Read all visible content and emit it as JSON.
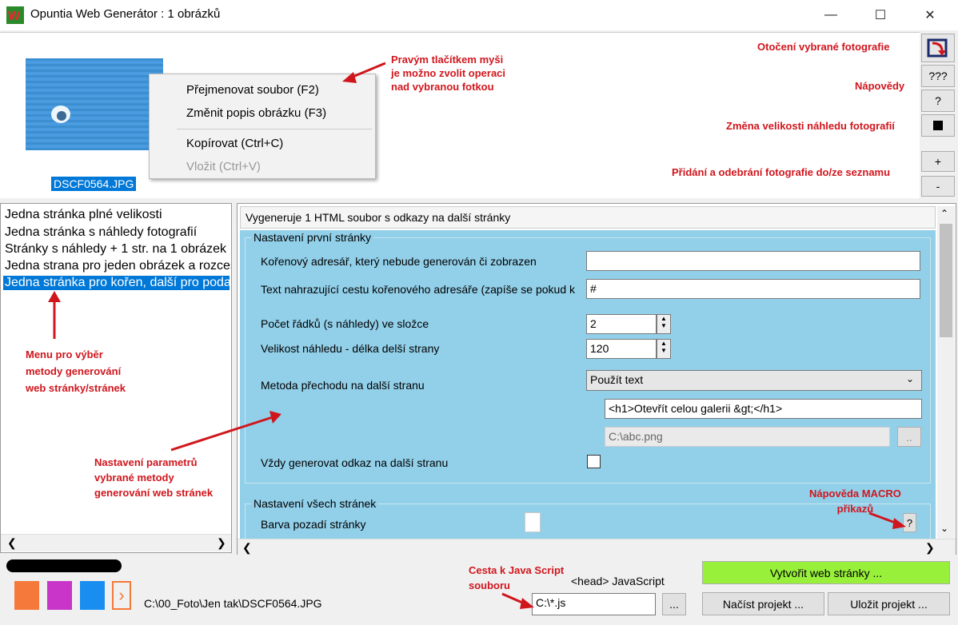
{
  "window": {
    "title": "Opuntia Web Generátor : 1 obrázků"
  },
  "thumbnail": {
    "filename": "DSCF0564.JPG"
  },
  "context_menu": {
    "items": [
      "Přejmenovat soubor (F2)",
      "Změnit popis obrázku (F3)",
      "Kopírovat (Ctrl+C)"
    ],
    "disabled_item": "Vložit (Ctrl+V)"
  },
  "annotations": {
    "context_menu": [
      "Pravým tlačítkem myši",
      "je možno zvolit operaci",
      "nad vybranou fotkou"
    ],
    "rotate": "Otočení vybrané fotografie",
    "help": "Nápovědy",
    "resize": "Změna velikosti náhledu fotografií",
    "add_remove": "Přidání a odebrání fotografie do/ze seznamu",
    "method_menu": [
      "Menu pro výběr",
      "metody generování",
      "web stránky/stránek"
    ],
    "params": [
      "Nastavení parametrů",
      "vybrané metody",
      "generování web stránek"
    ],
    "macro_help": [
      "Nápověda MACRO",
      "příkazů"
    ],
    "js_path": [
      "Cesta k Java Script",
      "souboru"
    ]
  },
  "side_buttons": {
    "help_all": "???",
    "help": "?",
    "add": "+",
    "remove": "-"
  },
  "methods": {
    "items": [
      "Jedna stránka plné velikosti",
      "Jedna stránka s náhledy fotografií",
      "Stránky s náhledy + 1 str. na 1 obrázek",
      "Jedna strana pro jeden obrázek a rozcestník",
      "Jedna stránka pro kořen, další pro podadresáře"
    ]
  },
  "panel": {
    "description": "Vygeneruje 1 HTML soubor s odkazy na další stránky",
    "group1": "Nastavení první stránky",
    "root_label": "Kořenový adresář, který nebude generován či zobrazen",
    "root_value": "",
    "text_label": "Text nahrazující cestu kořenového adresáře (zapíše se pokud k",
    "text_value": "#",
    "rows_label": "Počet řádků (s náhledy) ve složce",
    "rows_value": "2",
    "size_label": "Velikost náhledu - délka delší strany",
    "size_value": "120",
    "method_label": "Metoda přechodu na další stranu",
    "method_value": "Použít text",
    "html_value": "<h1>Otevřít celou galerii &gt;</h1>",
    "image_value": "C:\\abc.png",
    "browse": "..",
    "always_label": "Vždy generovat odkaz na další stranu",
    "group2": "Nastavení všech stránek",
    "bg_label": "Barva pozadí stránky",
    "macro_btn": "?"
  },
  "bottom": {
    "path": "C:\\00_Foto\\Jen tak\\DSCF0564.JPG",
    "js_label": "<head> JavaScript",
    "js_value": "C:\\*.js",
    "js_browse": "...",
    "generate": "Vytvořit web stránky ...",
    "load": "Načíst projekt ...",
    "save": "Uložit projekt ...",
    "colors": [
      "#f5793a",
      "#c935c9",
      "#1a8ef0"
    ],
    "generate_color": "#98f03a"
  }
}
